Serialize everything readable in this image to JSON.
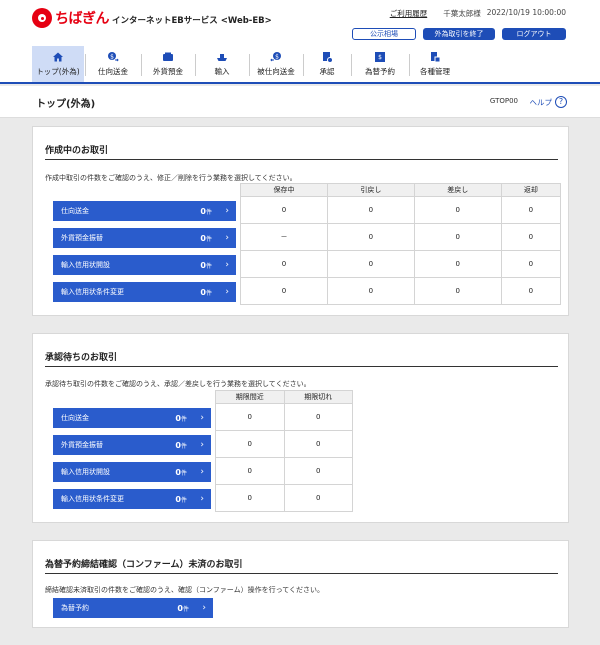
{
  "header": {
    "logo_text": "ちばぎん",
    "service_name": "インターネットEBサービス <Web-EB>",
    "usage_history": "ご利用履歴",
    "user_name": "千葉太郎様",
    "datetime": "2022/10/19 10:00:00",
    "btn_public_rates": "公示相場",
    "btn_end_fx": "外為取引を終了",
    "btn_logout": "ログアウト"
  },
  "nav": {
    "items": [
      {
        "label": "トップ(外為)",
        "icon": "home-icon"
      },
      {
        "label": "仕向送金",
        "icon": "remittance-icon"
      },
      {
        "label": "外貨預金",
        "icon": "deposit-icon"
      },
      {
        "label": "輸入",
        "icon": "import-icon"
      },
      {
        "label": "被仕向送金",
        "icon": "inbound-remittance-icon"
      },
      {
        "label": "承認",
        "icon": "approval-icon"
      },
      {
        "label": "為替予約",
        "icon": "fx-contract-icon"
      },
      {
        "label": "各種管理",
        "icon": "management-icon"
      }
    ]
  },
  "page": {
    "title": "トップ(外為)",
    "screen_id": "GTOP00",
    "help": "ヘルプ",
    "help_icon": "?"
  },
  "in_progress": {
    "title": "作成中のお取引",
    "desc": "作成中取引の件数をご確認のうえ、修正／削除を行う業務を選択してください。",
    "columns": [
      "保存中",
      "引戻し",
      "差戻し",
      "返却"
    ],
    "rows": [
      {
        "label": "仕向送金",
        "count": "0",
        "unit": "件",
        "cells": [
          "0",
          "0",
          "0",
          "0"
        ]
      },
      {
        "label": "外貨預金振替",
        "count": "0",
        "unit": "件",
        "cells": [
          "－",
          "0",
          "0",
          "0"
        ]
      },
      {
        "label": "輸入信用状開設",
        "count": "0",
        "unit": "件",
        "cells": [
          "0",
          "0",
          "0",
          "0"
        ]
      },
      {
        "label": "輸入信用状条件変更",
        "count": "0",
        "unit": "件",
        "cells": [
          "0",
          "0",
          "0",
          "0"
        ]
      }
    ]
  },
  "awaiting": {
    "title": "承認待ちのお取引",
    "desc": "承認待ち取引の件数をご確認のうえ、承認／差戻しを行う業務を選択してください。",
    "columns": [
      "期限間近",
      "期限切れ"
    ],
    "rows": [
      {
        "label": "仕向送金",
        "count": "0",
        "unit": "件",
        "cells": [
          "0",
          "0"
        ]
      },
      {
        "label": "外貨預金振替",
        "count": "0",
        "unit": "件",
        "cells": [
          "0",
          "0"
        ]
      },
      {
        "label": "輸入信用状開設",
        "count": "0",
        "unit": "件",
        "cells": [
          "0",
          "0"
        ]
      },
      {
        "label": "輸入信用状条件変更",
        "count": "0",
        "unit": "件",
        "cells": [
          "0",
          "0"
        ]
      }
    ]
  },
  "confirm": {
    "title": "為替予約締結確認（コンファーム）未済のお取引",
    "desc": "締結確認未済取引の件数をご確認のうえ、確認（コンファーム）操作を行ってください。",
    "row": {
      "label": "為替予約",
      "count": "0",
      "unit": "件"
    }
  },
  "colors": {
    "accent": "#1e4db7",
    "button": "#2a5ccc",
    "brand": "#e60012",
    "active_nav": "#cfdcf6"
  }
}
